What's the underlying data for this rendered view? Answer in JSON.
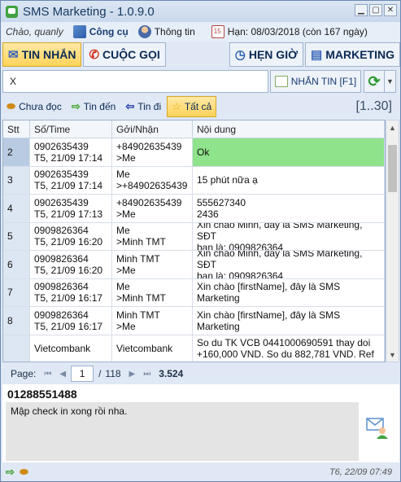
{
  "window": {
    "title": "SMS Marketing - 1.0.9.0"
  },
  "infobar": {
    "greeting": "Chào, quanly",
    "tools_label": "Công cụ",
    "info_label": "Thông tin",
    "expiry": "Hạn: 08/03/2018 (còn 167 ngày)"
  },
  "tabs": [
    {
      "label": "TIN NHẮN",
      "icon": "envelope-icon"
    },
    {
      "label": "CUỘC GỌI",
      "icon": "phone-icon"
    },
    {
      "label": "HẸN GIỜ",
      "icon": "clock-icon"
    },
    {
      "label": "MARKETING",
      "icon": "marketing-icon"
    }
  ],
  "search": {
    "value": "X"
  },
  "message_button": {
    "label": "NHẮN TIN [F1]"
  },
  "filters": [
    {
      "label": "Chưa đọc"
    },
    {
      "label": "Tin đến"
    },
    {
      "label": "Tin đi"
    },
    {
      "label": "Tất cả"
    }
  ],
  "range": "[1..30]",
  "table": {
    "headers": [
      "Stt",
      "Số/Time",
      "Gởi/Nhận",
      "Nội dung"
    ],
    "rows": [
      {
        "stt": "2",
        "num": "0902635439",
        "time": "T5, 21/09 17:14",
        "from": "+84902635439",
        "to": ">Me",
        "content1": "Ok",
        "content2": ""
      },
      {
        "stt": "3",
        "num": "0902635439",
        "time": "T5, 21/09 17:14",
        "from": "Me",
        "to": ">+84902635439",
        "content1": "15 phút nữa ạ",
        "content2": ""
      },
      {
        "stt": "4",
        "num": "0902635439",
        "time": "T5, 21/09 17:13",
        "from": "+84902635439",
        "to": ">Me",
        "content1": "555627340",
        "content2": "2436"
      },
      {
        "stt": "5",
        "num": "0909826364",
        "time": "T5, 21/09 16:20",
        "from": "Me",
        "to": ">Minh TMT",
        "content1": "Xin chào Minh, đây là SMS Marketing, SĐT",
        "content2": "bạn là: 0909826364"
      },
      {
        "stt": "6",
        "num": "0909826364",
        "time": "T5, 21/09 16:20",
        "from": "Minh TMT",
        "to": ">Me",
        "content1": "Xin chào Minh, đây là SMS Marketing, SĐT",
        "content2": "bạn là: 0909826364"
      },
      {
        "stt": "7",
        "num": "0909826364",
        "time": "T5, 21/09 16:17",
        "from": "Me",
        "to": ">Minh TMT",
        "content1": "Xin chào [firstName], đây là SMS",
        "content2": "Marketing"
      },
      {
        "stt": "8",
        "num": "0909826364",
        "time": "T5, 21/09 16:17",
        "from": "Minh TMT",
        "to": ">Me",
        "content1": "Xin chào [firstName], đây là SMS",
        "content2": "Marketing"
      },
      {
        "stt": "",
        "num": "Vietcombank",
        "time": "",
        "from": "Vietcombank",
        "to": "",
        "content1": "So du TK VCB 0441000690591 thay doi",
        "content2": "+160,000 VND. So du 882,781 VND. Ref"
      }
    ]
  },
  "pager": {
    "label": "Page:",
    "current": "1",
    "separator": "/",
    "total": "118",
    "count": "3.524"
  },
  "detail": {
    "phone": "01288551488",
    "body": "Mập check in xong rồi nha."
  },
  "footer": {
    "time": "T6, 22/09 07:49"
  }
}
